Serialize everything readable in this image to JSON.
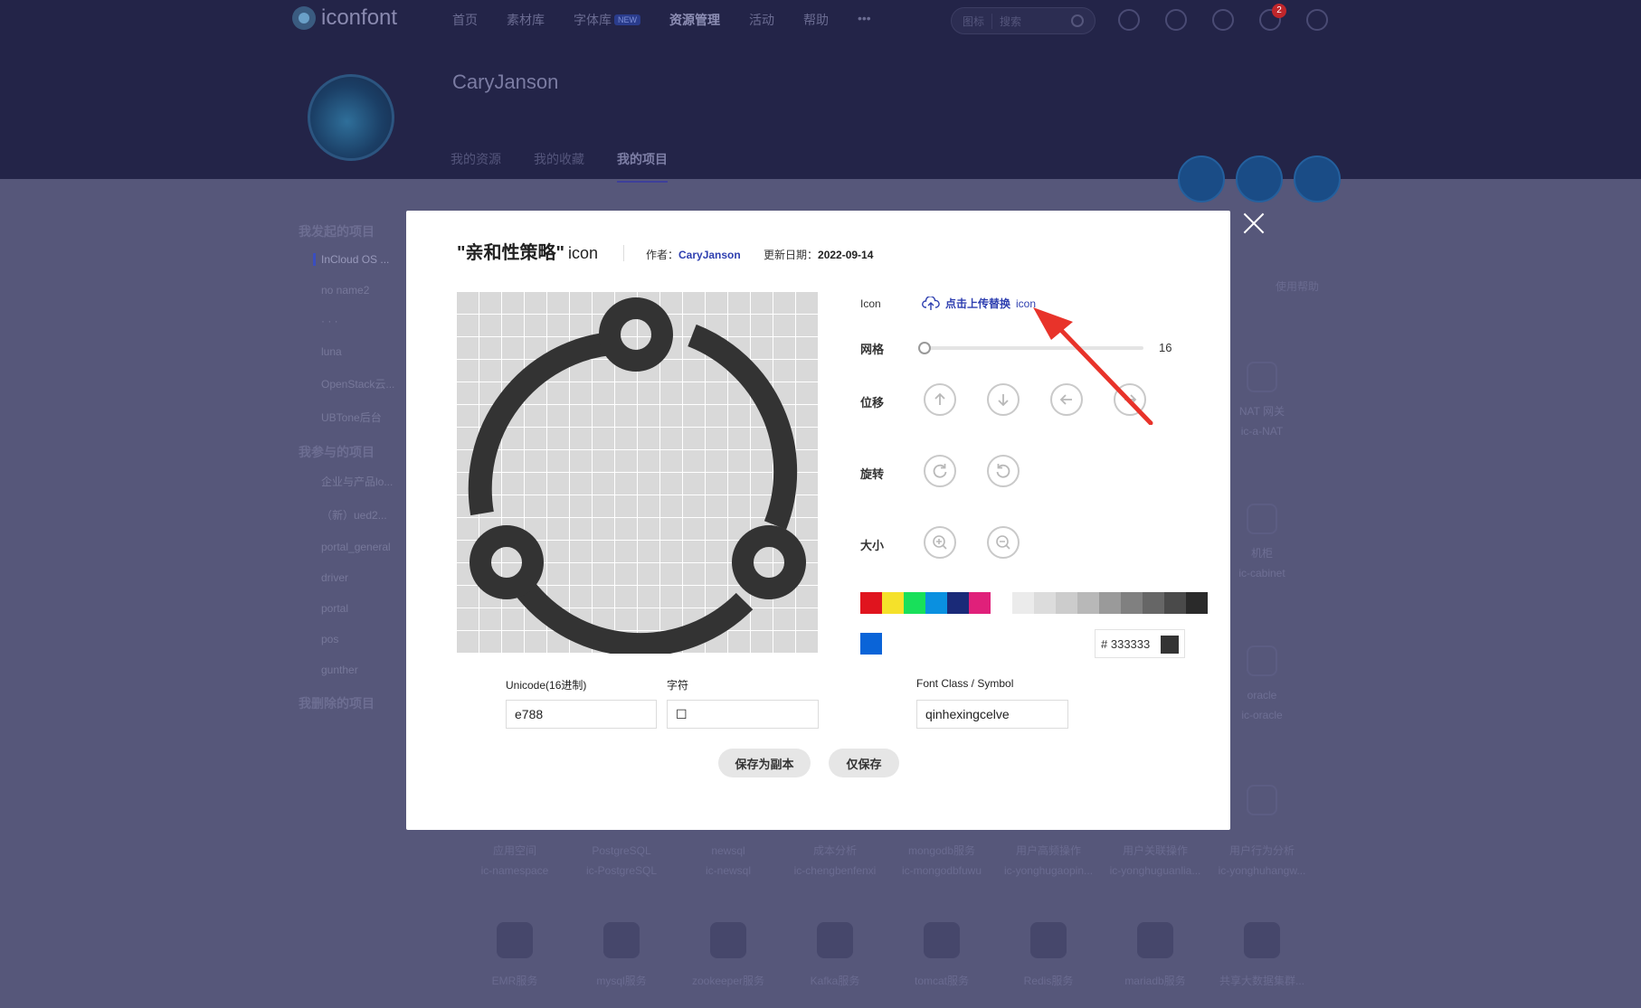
{
  "topnav": {
    "logo_text": "iconfont",
    "items": [
      "首页",
      "素材库",
      "字体库",
      "资源管理",
      "活动",
      "帮助",
      "•••"
    ],
    "new_badge": "NEW",
    "search_scope": "图标",
    "search_placeholder": "搜索",
    "notification_count": "2"
  },
  "profile": {
    "username": "CaryJanson",
    "tabs": [
      "我的资源",
      "我的收藏",
      "我的项目"
    ]
  },
  "sidebar": {
    "created_title": "我发起的项目",
    "created_items": [
      "InCloud OS ...",
      "no name2",
      "· · ·",
      "luna",
      "OpenStack云...",
      "UBTone后台"
    ],
    "joined_title": "我参与的项目",
    "joined_items": [
      "企业与产品lo...",
      "（新）ued2...",
      "portal_general",
      "driver",
      "portal",
      "pos",
      "gunther"
    ],
    "deleted_title": "我删除的项目"
  },
  "right_panel": {
    "help": "使用帮助",
    "tiles": [
      {
        "name": "NAT 网关",
        "code": "ic-a-NAT"
      },
      {
        "name": "机柜",
        "code": "ic-cabinet"
      },
      {
        "name": "oracle",
        "code": "ic-oracle"
      }
    ]
  },
  "bottom_row1": [
    {
      "name": "应用空间",
      "code": "ic-namespace"
    },
    {
      "name": "PostgreSQL",
      "code": "ic-PostgreSQL"
    },
    {
      "name": "newsql",
      "code": "ic-newsql"
    },
    {
      "name": "成本分析",
      "code": "ic-chengbenfenxi"
    },
    {
      "name": "mongodb服务",
      "code": "ic-mongodbfuwu"
    },
    {
      "name": "用户高频操作",
      "code": "ic-yonghugaopin..."
    },
    {
      "name": "用户关联操作",
      "code": "ic-yonghuguanlia..."
    },
    {
      "name": "用户行为分析",
      "code": "ic-yonghuhangw..."
    }
  ],
  "bottom_row2": [
    "EMR服务",
    "mysql服务",
    "zookeeper服务",
    "Kafka服务",
    "tomcat服务",
    "Redis服务",
    "mariadb服务",
    "共享大数据集群..."
  ],
  "modal": {
    "title": "\"亲和性策略\"",
    "title_suffix": "icon",
    "author_label": "作者：",
    "author": "CaryJanson",
    "date_label": "更新日期：",
    "date": "2022-09-14",
    "icon_label": "Icon",
    "upload_text": "点击上传替换",
    "upload_suffix": "icon",
    "grid_label": "网格",
    "grid_value": "16",
    "grid_fraction": 0,
    "move_label": "位移",
    "rotate_label": "旋转",
    "size_label": "大小",
    "palette": [
      "#e0141e",
      "#f5e12a",
      "#18e05a",
      "#0a90e0",
      "#1a2a78",
      "#e0207a",
      "#ffffff",
      "#ebebeb",
      "#dcdcdc",
      "#cccccc",
      "#b8b8b8",
      "#9a9a9a",
      "#808080",
      "#666666",
      "#4a4a4a",
      "#2a2a2a"
    ],
    "custom_color": "#0a64d8",
    "hex_prefix": "#",
    "hex_value": "333333",
    "icon_color": "#333333",
    "unicode_label": "Unicode(16进制)",
    "unicode_value": "e788",
    "char_label": "字符",
    "char_value": "☐",
    "fontclass_label": "Font Class / Symbol",
    "fontclass_value": "qinhexingcelve",
    "save_copy": "保存为副本",
    "save_only": "仅保存"
  }
}
